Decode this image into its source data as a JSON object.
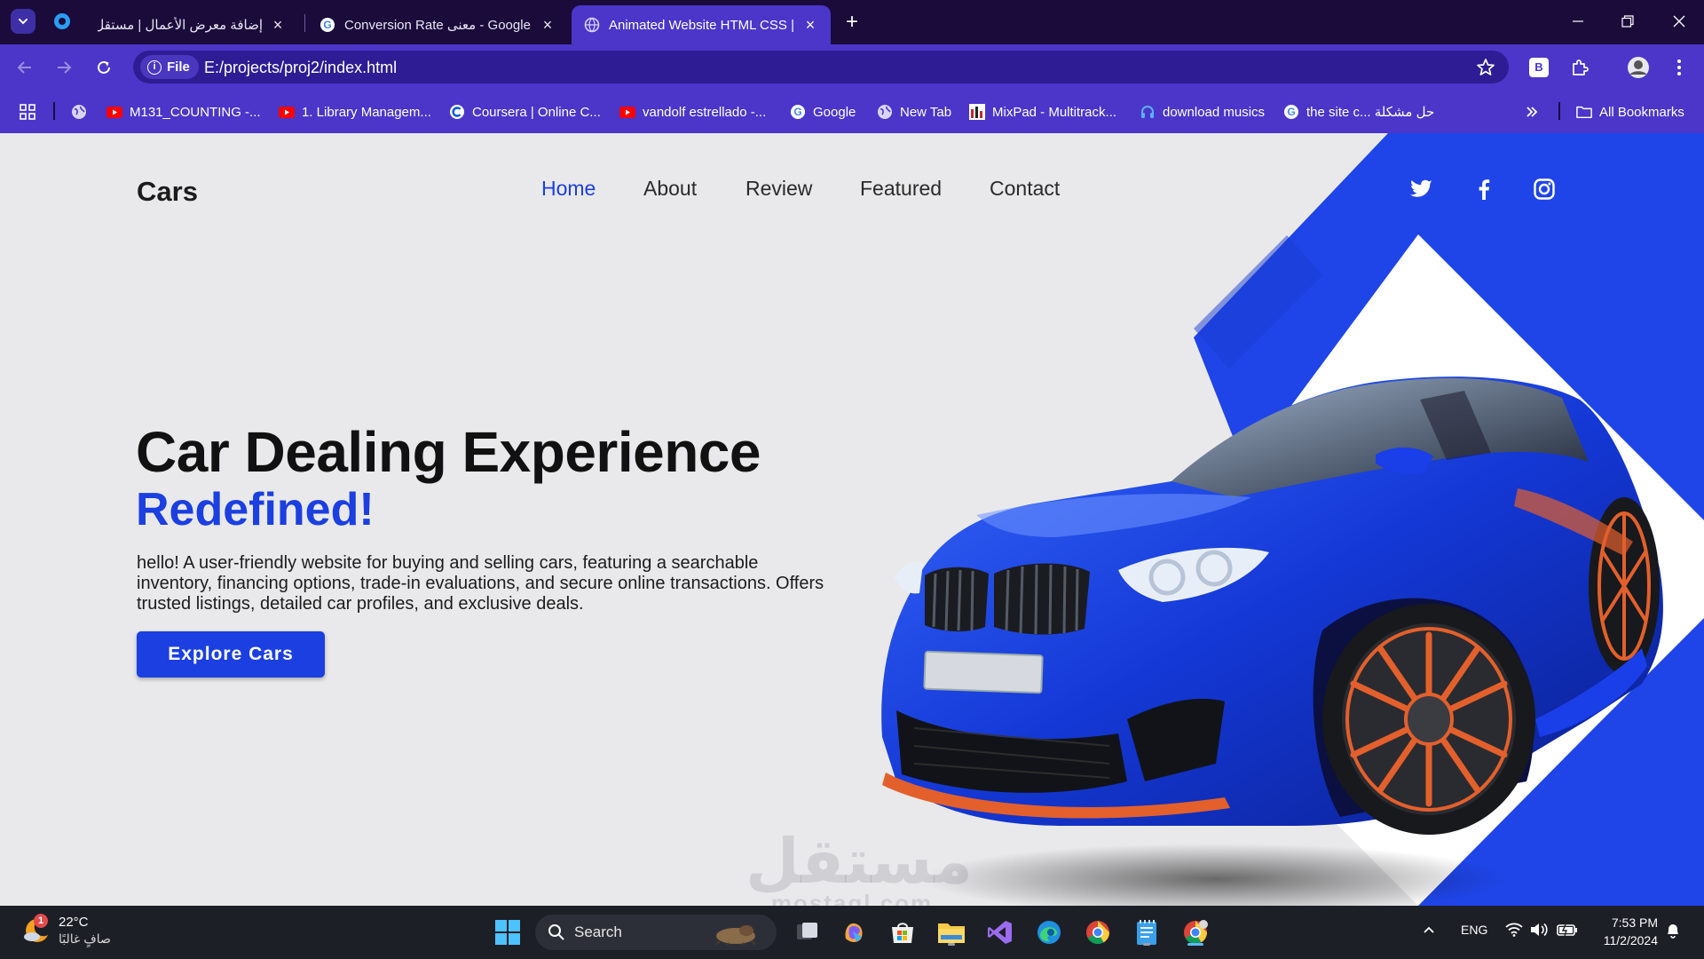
{
  "browser": {
    "tabs": [
      {
        "title": "إضافة معرض الأعمال | مستقل",
        "active": false
      },
      {
        "title": "Conversion Rate معنى - Google",
        "active": false
      },
      {
        "title": "Animated Website HTML CSS | Car",
        "active": true
      }
    ],
    "url_scheme_label": "File",
    "url": "E:/projects/proj2/index.html",
    "profile_letter": "B",
    "bookmarks": [
      "M131_COUNTING -...",
      "1. Library Managem...",
      "Coursera | Online C...",
      "vandolf estrellado -...",
      "Google",
      "New Tab",
      "MixPad - Multitrack...",
      "download musics",
      "the site c... حل مشكلة"
    ],
    "all_bookmarks_label": "All Bookmarks"
  },
  "site": {
    "logo": "Cars",
    "nav": [
      "Home",
      "About",
      "Review",
      "Featured",
      "Contact"
    ],
    "active_nav": "Home",
    "hero": {
      "title": "Car Dealing Experience",
      "highlight": "Redefined!",
      "description": "hello! A user-friendly website for buying and selling cars, featuring a searchable inventory, financing options, trade-in evaluations, and secure online transactions. Offers trusted listings, detailed car profiles, and exclusive deals.",
      "cta": "Explore Cars"
    },
    "social_icons": [
      "twitter-icon",
      "facebook-icon",
      "instagram-icon"
    ],
    "accent_color": "#1b3fe0"
  },
  "watermark": {
    "arabic": "مستقل",
    "latin": "mostaql.com"
  },
  "taskbar": {
    "weather_temp": "22°C",
    "weather_desc": "صافٍ غالبًا",
    "weather_badge": "1",
    "search_label": "Search",
    "language": "ENG",
    "time": "7:53 PM",
    "date": "11/2/2024"
  }
}
